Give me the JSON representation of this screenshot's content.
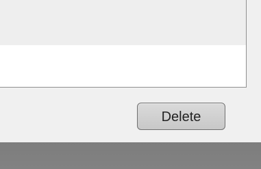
{
  "list": {
    "rows": [
      {
        "text": ""
      },
      {
        "text": ""
      }
    ]
  },
  "actions": {
    "delete_label": "Delete"
  },
  "colors": {
    "background": "#f0f0f0",
    "list_background": "#ffffff",
    "list_border": "#8f8f8f",
    "button_fill": "#cfcfcf",
    "button_border": "#6f6f6f",
    "bottom_bar": "#808080"
  }
}
